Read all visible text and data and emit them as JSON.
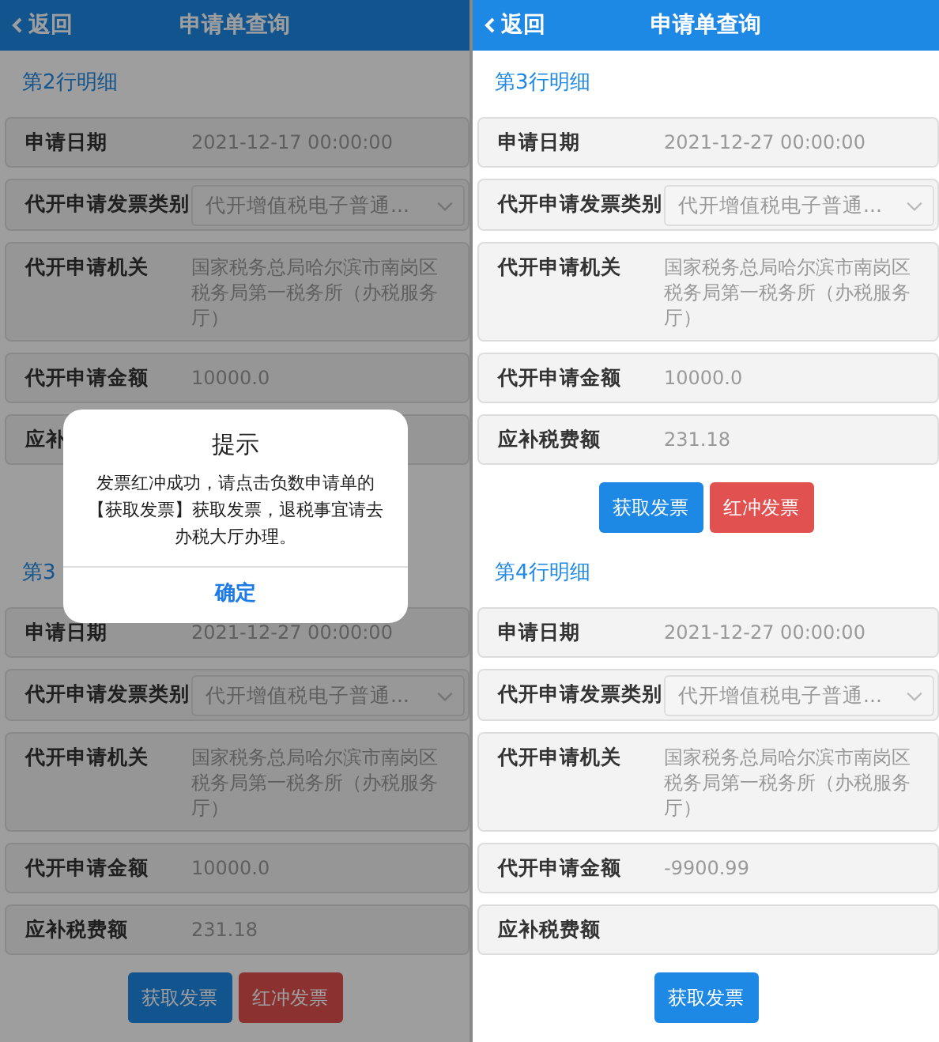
{
  "screens": [
    {
      "header": {
        "back": "返回",
        "title": "申请单查询"
      },
      "dimmed": true,
      "sections": [
        {
          "title": "第2行明细",
          "fields": [
            {
              "kind": "text",
              "label": "申请日期",
              "value": "2021-12-17 00:00:00"
            },
            {
              "kind": "select",
              "label": "代开申请发票类别",
              "value": "代开增值税电子普通..."
            },
            {
              "kind": "text",
              "label": "代开申请机关",
              "value": "国家税务总局哈尔滨市南岗区税务局第一税务所（办税服务厅）"
            },
            {
              "kind": "text",
              "label": "代开申请金额",
              "value": "10000.0"
            },
            {
              "kind": "text",
              "label": "应补"
            }
          ]
        },
        {
          "title": "第3",
          "fields": [
            {
              "kind": "text",
              "label": "申请日期",
              "value": "2021-12-27 00:00:00"
            },
            {
              "kind": "select",
              "label": "代开申请发票类别",
              "value": "代开增值税电子普通..."
            },
            {
              "kind": "text",
              "label": "代开申请机关",
              "value": "国家税务总局哈尔滨市南岗区税务局第一税务所（办税服务厅）"
            },
            {
              "kind": "text",
              "label": "代开申请金额",
              "value": "10000.0"
            },
            {
              "kind": "text",
              "label": "应补税费额",
              "value": "231.18"
            }
          ],
          "buttons": [
            {
              "kind": "primary",
              "label": "获取发票"
            },
            {
              "kind": "danger",
              "label": "红冲发票"
            }
          ]
        }
      ],
      "dialog": {
        "title": "提示",
        "message": "发票红冲成功，请点击负数申请单的【获取发票】获取发票，退税事宜请去办税大厅办理。",
        "button": "确定"
      }
    },
    {
      "header": {
        "back": "返回",
        "title": "申请单查询"
      },
      "dimmed": false,
      "sections": [
        {
          "title": "第3行明细",
          "fields": [
            {
              "kind": "text",
              "label": "申请日期",
              "value": "2021-12-27 00:00:00"
            },
            {
              "kind": "select",
              "label": "代开申请发票类别",
              "value": "代开增值税电子普通..."
            },
            {
              "kind": "text",
              "label": "代开申请机关",
              "value": "国家税务总局哈尔滨市南岗区税务局第一税务所（办税服务厅）"
            },
            {
              "kind": "text",
              "label": "代开申请金额",
              "value": "10000.0"
            },
            {
              "kind": "text",
              "label": "应补税费额",
              "value": "231.18"
            }
          ],
          "buttons": [
            {
              "kind": "primary",
              "label": "获取发票"
            },
            {
              "kind": "danger",
              "label": "红冲发票"
            }
          ]
        },
        {
          "title": "第4行明细",
          "fields": [
            {
              "kind": "text",
              "label": "申请日期",
              "value": "2021-12-27 00:00:00"
            },
            {
              "kind": "select",
              "label": "代开申请发票类别",
              "value": "代开增值税电子普通..."
            },
            {
              "kind": "text",
              "label": "代开申请机关",
              "value": "国家税务总局哈尔滨市南岗区税务局第一税务所（办税服务厅）"
            },
            {
              "kind": "text",
              "label": "代开申请金额",
              "value": "-9900.99"
            },
            {
              "kind": "text",
              "label": "应补税费额"
            }
          ],
          "buttons": [
            {
              "kind": "primary",
              "label": "获取发票"
            }
          ]
        }
      ]
    }
  ]
}
